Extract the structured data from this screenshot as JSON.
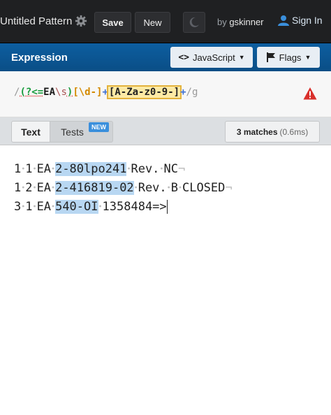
{
  "header": {
    "title": "Untitled Pattern",
    "save_label": "Save",
    "new_label": "New",
    "by_prefix": "by",
    "username": "gskinner",
    "signin_label": "Sign In"
  },
  "expression": {
    "label": "Expression",
    "language_label": "JavaScript",
    "flags_label": "Flags",
    "regex_parts": {
      "open_slash": "/",
      "lookbehind_open": "(?<=",
      "literal": "EA",
      "escape": "\\s",
      "lookbehind_close": ")",
      "set1": "[\\d-]",
      "quant1": "+",
      "set2": "[A-Za-z0-9-]",
      "quant2": "+",
      "close_slash": "/",
      "flags": "g"
    }
  },
  "tabs": {
    "text_label": "Text",
    "tests_label": "Tests",
    "tests_badge": "NEW",
    "matches_count": "3 matches",
    "matches_time": "(0.6ms)"
  },
  "text_lines": [
    {
      "pre": "1",
      "a": "1",
      "b": "EA",
      "match": "2-80lpo241",
      "c": "Rev.",
      "d": "NC",
      "e": ""
    },
    {
      "pre": "1",
      "a": "2",
      "b": "EA",
      "match": "2-416819-02",
      "c": "Rev.",
      "d": "B",
      "e": "CLOSED"
    },
    {
      "pre": "3",
      "a": "1",
      "b": "EA",
      "match": "540-OI",
      "c": "1358484=>",
      "d": "",
      "e": ""
    }
  ],
  "colors": {
    "topbar": "#1f2022",
    "expression_bar": "#0d5ea0",
    "match_highlight": "#b8d7f2",
    "warning": "#d9302c",
    "badge": "#3a8fdc"
  }
}
